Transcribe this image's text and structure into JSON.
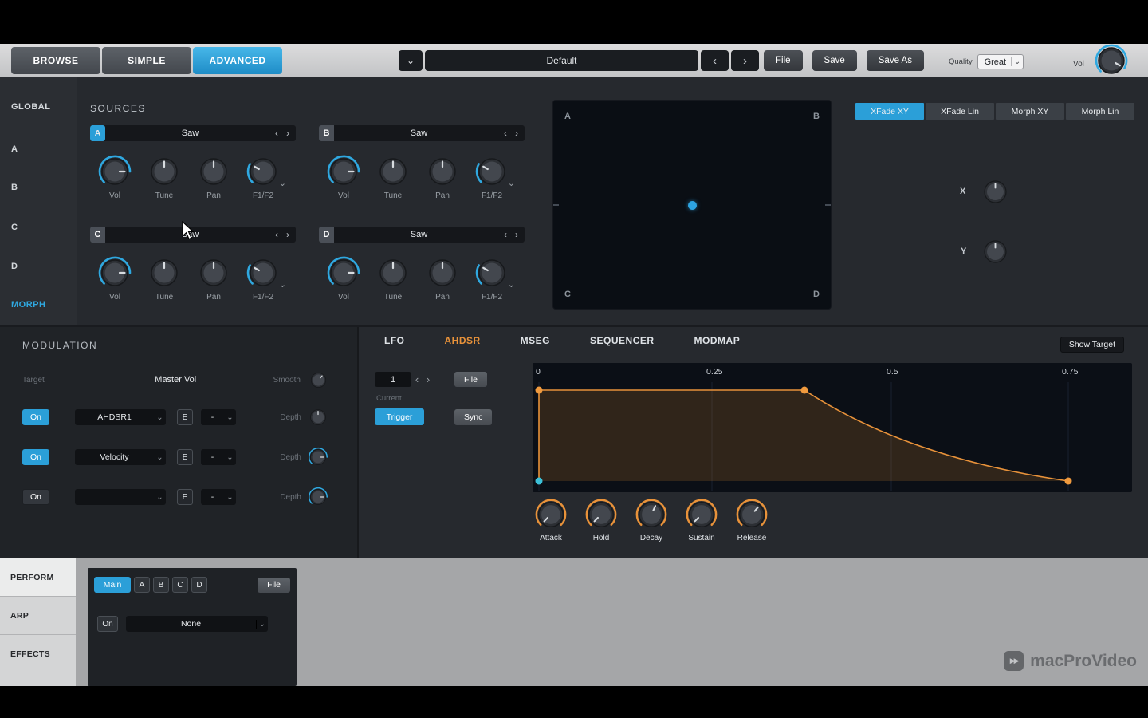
{
  "icons": {
    "chev_down": "⌄",
    "chev_left": "‹",
    "chev_right": "›",
    "play_double": "▶▶"
  },
  "header": {
    "views": [
      {
        "label": "BROWSE"
      },
      {
        "label": "SIMPLE"
      },
      {
        "label": "ADVANCED"
      }
    ],
    "preset": {
      "value": "Default"
    },
    "actions": [
      {
        "label": "File"
      },
      {
        "label": "Save"
      },
      {
        "label": "Save As"
      }
    ],
    "quality": {
      "label": "Quality",
      "value": "Great"
    },
    "volume": {
      "label": "Vol"
    }
  },
  "nav": {
    "items": [
      {
        "label": "GLOBAL"
      },
      {
        "label": "A"
      },
      {
        "label": "B"
      },
      {
        "label": "C"
      },
      {
        "label": "D"
      },
      {
        "label": "MORPH"
      }
    ]
  },
  "sources": {
    "title": "SOURCES",
    "slots": [
      {
        "id": "A",
        "wave": "Saw",
        "knobs": [
          "Vol",
          "Tune",
          "Pan",
          "F1/F2"
        ]
      },
      {
        "id": "B",
        "wave": "Saw",
        "knobs": [
          "Vol",
          "Tune",
          "Pan",
          "F1/F2"
        ]
      },
      {
        "id": "C",
        "wave": "Saw",
        "knobs": [
          "Vol",
          "Tune",
          "Pan",
          "F1/F2"
        ]
      },
      {
        "id": "D",
        "wave": "Saw",
        "knobs": [
          "Vol",
          "Tune",
          "Pan",
          "F1/F2"
        ]
      }
    ]
  },
  "xy_pad": {
    "tl": "A",
    "tr": "B",
    "bl": "C",
    "br": "D"
  },
  "morph": {
    "tabs": [
      {
        "label": "XFade XY"
      },
      {
        "label": "XFade Lin"
      },
      {
        "label": "Morph XY"
      },
      {
        "label": "Morph Lin"
      }
    ],
    "x_label": "X",
    "y_label": "Y"
  },
  "modulation": {
    "title": "MODULATION",
    "target_label": "Target",
    "target_value": "Master Vol",
    "smooth_label": "Smooth",
    "rows": [
      {
        "on": "On",
        "source": "AHDSR1",
        "e": "E",
        "curve": "-",
        "depth_label": "Depth"
      },
      {
        "on": "On",
        "source": "Velocity",
        "e": "E",
        "curve": "-",
        "depth_label": "Depth"
      },
      {
        "on": "On",
        "source": "",
        "e": "E",
        "curve": "-",
        "depth_label": "Depth"
      }
    ]
  },
  "editor": {
    "tabs": [
      {
        "label": "LFO"
      },
      {
        "label": "AHDSR"
      },
      {
        "label": "MSEG"
      },
      {
        "label": "SEQUENCER"
      },
      {
        "label": "MODMAP"
      }
    ],
    "show_target": "Show Target",
    "index": "1",
    "current_label": "Current",
    "file_button": "File",
    "trigger_button": "Trigger",
    "sync_button": "Sync",
    "envelope": {
      "time_labels": [
        "0",
        "0.25",
        "0.5",
        "0.75"
      ],
      "knob_labels": [
        "Attack",
        "Hold",
        "Decay",
        "Sustain",
        "Release"
      ]
    }
  },
  "perform": {
    "nav": [
      {
        "label": "PERFORM"
      },
      {
        "label": "ARP"
      },
      {
        "label": "EFFECTS"
      }
    ],
    "tabs": [
      {
        "label": "Main"
      },
      {
        "label": "A"
      },
      {
        "label": "B"
      },
      {
        "label": "C"
      },
      {
        "label": "D"
      }
    ],
    "file_button": "File",
    "on_button": "On",
    "mode_value": "None"
  },
  "watermark": "macProVideo",
  "colors": {
    "accent_blue": "#2b9fd8",
    "accent_orange": "#e8923a"
  }
}
